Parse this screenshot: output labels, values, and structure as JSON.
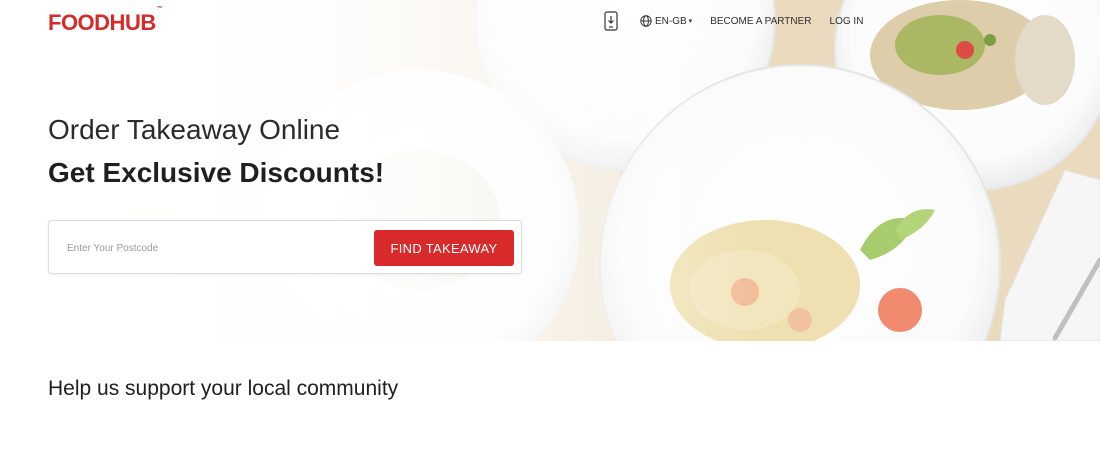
{
  "brand": {
    "logo_text": "FOODHUB",
    "trademark": "™",
    "color": "#d42b2b"
  },
  "nav": {
    "app_icon": "mobile-download-icon",
    "language_icon": "globe-icon",
    "language": "EN-GB",
    "language_caret": "▾",
    "become_partner": "BECOME A PARTNER",
    "login": "LOG IN"
  },
  "hero": {
    "title": "Order Takeaway Online",
    "subtitle": "Get Exclusive Discounts!",
    "search": {
      "placeholder": "Enter Your Postcode",
      "value": "",
      "button_label": "FIND TAKEAWAY",
      "button_color": "#d82a2a"
    }
  },
  "community": {
    "title": "Help us support your local community"
  }
}
